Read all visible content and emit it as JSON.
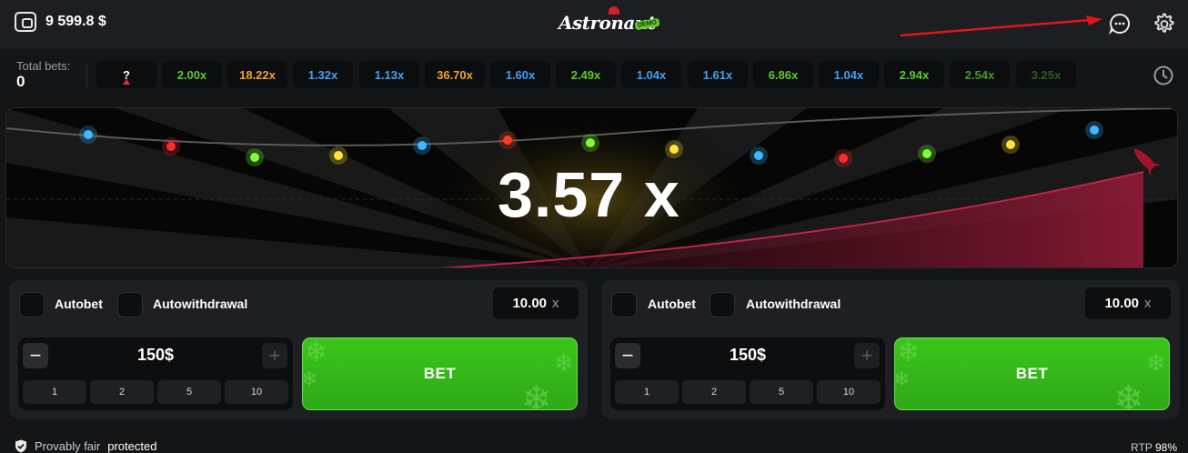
{
  "header": {
    "balance": "9 599.8 $",
    "logo_text": "Astronaut",
    "logo_badge": "DEMO",
    "icons": [
      "wallet-icon",
      "chat-icon",
      "gear-icon"
    ]
  },
  "multipliers": {
    "total_label": "Total bets:",
    "total_value": "0",
    "current": "?",
    "history": [
      {
        "value": "2.00x",
        "color": "#5ecb2b"
      },
      {
        "value": "18.22x",
        "color": "#f2a52a"
      },
      {
        "value": "1.32x",
        "color": "#3fa2f5"
      },
      {
        "value": "1.13x",
        "color": "#3fa2f5"
      },
      {
        "value": "36.70x",
        "color": "#f2a52a"
      },
      {
        "value": "1.60x",
        "color": "#3fa2f5"
      },
      {
        "value": "2.49x",
        "color": "#5ecb2b"
      },
      {
        "value": "1.04x",
        "color": "#3fa2f5"
      },
      {
        "value": "1.61x",
        "color": "#3fa2f5"
      },
      {
        "value": "6.86x",
        "color": "#5ecb2b"
      },
      {
        "value": "1.04x",
        "color": "#3fa2f5"
      },
      {
        "value": "2.94x",
        "color": "#5ecb2b"
      },
      {
        "value": "2.54x",
        "color": "#4a9a2a"
      },
      {
        "value": "3.25x",
        "color": "#2d5e1e"
      }
    ]
  },
  "game": {
    "multiplier": "3.57 x"
  },
  "panels": [
    {
      "autobet_label": "Autobet",
      "autowithdrawal_label": "Autowithdrawal",
      "auto_value": "10.00",
      "auto_suffix": "x",
      "minus": "−",
      "plus": "+",
      "amount": "150$",
      "quick": [
        "1",
        "2",
        "5",
        "10"
      ],
      "bet_label": "BET"
    },
    {
      "autobet_label": "Autobet",
      "autowithdrawal_label": "Autowithdrawal",
      "auto_value": "10.00",
      "auto_suffix": "x",
      "minus": "−",
      "plus": "+",
      "amount": "150$",
      "quick": [
        "1",
        "2",
        "5",
        "10"
      ],
      "bet_label": "BET"
    }
  ],
  "footer": {
    "fair_label": "Provably fair",
    "fair_status": "protected",
    "rtp_label": "RTP",
    "rtp_value": "98%"
  },
  "colors": {
    "accent_green": "#35b51a",
    "accent_red": "#e22f3b"
  }
}
